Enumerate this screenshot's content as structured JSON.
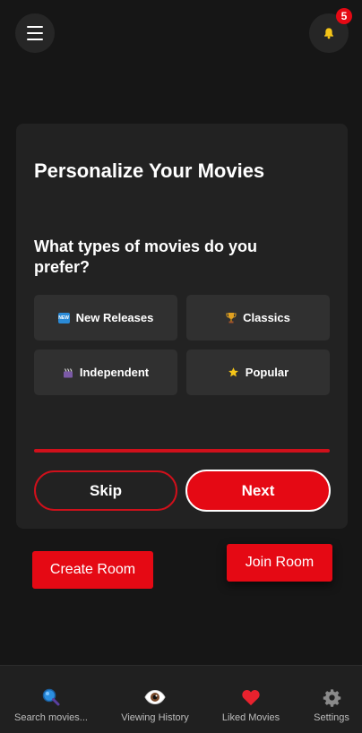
{
  "header": {
    "notification_count": "5"
  },
  "onboarding": {
    "title": "Personalize Your Movies",
    "question": "What types of movies do you prefer?",
    "options": [
      {
        "label": "New Releases",
        "icon": "new-badge-icon"
      },
      {
        "label": "Classics",
        "icon": "trophy-icon"
      },
      {
        "label": "Independent",
        "icon": "clapperboard-icon"
      },
      {
        "label": "Popular",
        "icon": "star-icon"
      }
    ],
    "skip_label": "Skip",
    "next_label": "Next"
  },
  "rooms": {
    "create_label": "Create Room",
    "join_label": "Join Room"
  },
  "bottom_nav": [
    {
      "label": "Search movies...",
      "icon": "search-icon"
    },
    {
      "label": "Viewing History",
      "icon": "eye-icon"
    },
    {
      "label": "Liked Movies",
      "icon": "heart-icon"
    },
    {
      "label": "Settings",
      "icon": "gear-icon"
    }
  ],
  "colors": {
    "background": "#161616",
    "card": "#222222",
    "accent": "#e50914",
    "option": "#303030"
  }
}
